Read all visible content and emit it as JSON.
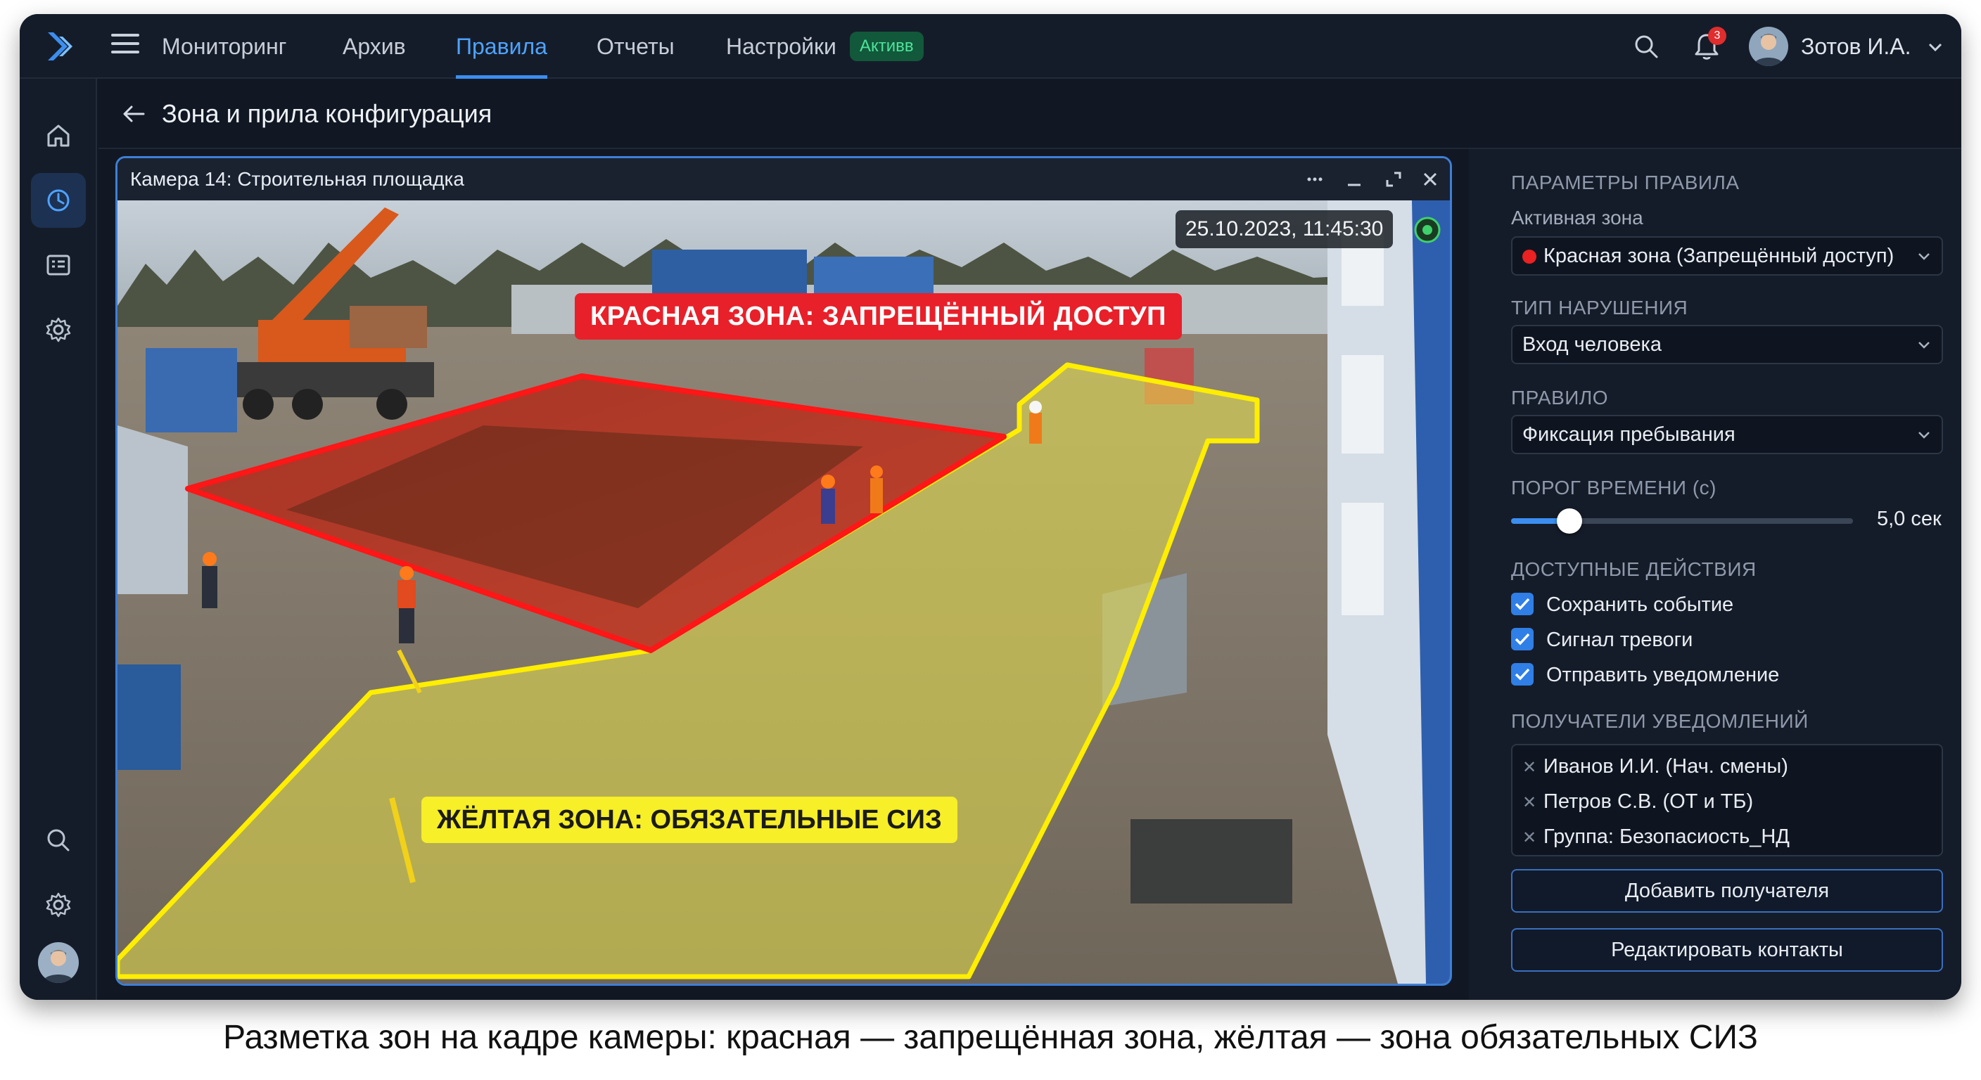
{
  "nav": {
    "tabs": [
      {
        "label": "Мониторинг"
      },
      {
        "label": "Архив"
      },
      {
        "label": "Правила"
      },
      {
        "label": "Отчеты"
      },
      {
        "label": "Настройки"
      }
    ],
    "active_tab": "Правила",
    "active_badge": "Активв",
    "notifications_count": "3",
    "user_name": "Зотов И.А."
  },
  "page": {
    "title": "Зона и прила конфигурация"
  },
  "camera": {
    "title": "Камера 14: Строительная площадка",
    "timestamp": "25.10.2023, 11:45:30",
    "red_zone_label": "КРАСНАЯ ЗОНА: ЗАПРЕЩЁННЫЙ ДОСТУП",
    "yellow_zone_label": "ЖЁЛТАЯ ЗОНА: ОБЯЗАТЕЛЬНЫЕ СИЗ"
  },
  "rule_panel": {
    "section_title": "ПАРАМЕТРЫ ПРАВИЛА",
    "active_zone_label": "Активная зона",
    "active_zone_value": "Красная зона (Запрещённый доступ)",
    "violation_type_label": "ТИП НАРУШЕНИЯ",
    "violation_type_value": "Вход человека",
    "rule_label": "ПРАВИЛО",
    "rule_value": "Фиксация пребывания",
    "time_threshold_label": "ПОРОГ ВРЕМЕНИ (с)",
    "time_threshold_value": "5,0 сек",
    "time_threshold_fraction": 0.17,
    "actions_label": "ДОСТУПНЫЕ ДЕЙСТВИЯ",
    "actions": [
      {
        "label": "Сохранить событие",
        "checked": true
      },
      {
        "label": "Сигнал тревоги",
        "checked": true
      },
      {
        "label": "Отправить уведомление",
        "checked": true
      }
    ],
    "recipients_label": "ПОЛУЧАТЕЛИ УВЕДОМЛЕНИЙ",
    "recipients": [
      "Иванов И.И. (Нач. смены)",
      "Петров С.В. (ОТ и ТБ)",
      "Группа: Безопасиость_НД"
    ],
    "add_recipient_button": "Добавить получателя",
    "edit_contacts_button": "Редактировать контакты"
  },
  "caption": "Разметка зон на кадре камеры: красная — запрещённая зона, жёлтая — зона обязательных СИЗ",
  "colors": {
    "accent": "#3b8ef0",
    "red_zone": "#e8202a",
    "yellow_zone": "#f7ef27",
    "badge_green": "#4de39a"
  },
  "icons": [
    "logo-icon",
    "menu-icon",
    "search-icon",
    "bell-icon",
    "chevron-down-icon",
    "home-icon",
    "clock-icon",
    "list-icon",
    "gear-icon",
    "back-arrow-icon",
    "more-icon",
    "minimize-icon",
    "maximize-icon",
    "close-icon",
    "live-icon",
    "check-icon",
    "remove-icon"
  ]
}
